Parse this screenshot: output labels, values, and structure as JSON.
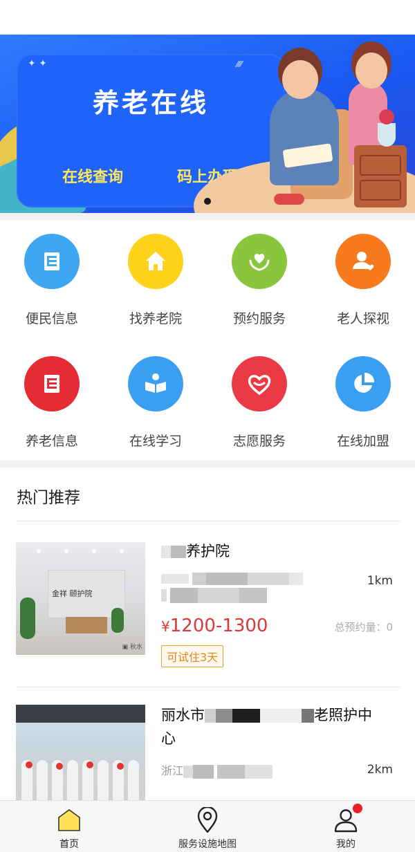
{
  "banner": {
    "title": "养老在线",
    "link_query": "在线查询",
    "link_handle": "码上办理"
  },
  "services": {
    "row1": [
      {
        "label": "便民信息",
        "icon": "document-icon",
        "color": "#3ea7f2"
      },
      {
        "label": "找养老院",
        "icon": "house-icon",
        "color": "#ffd21c"
      },
      {
        "label": "预约服务",
        "icon": "heart-hands-icon",
        "color": "#8ac53e"
      },
      {
        "label": "老人探视",
        "icon": "person-heart-icon",
        "color": "#f77a1f"
      }
    ],
    "row2": [
      {
        "label": "养老信息",
        "icon": "document-icon",
        "color": "#e52b34"
      },
      {
        "label": "在线学习",
        "icon": "reading-icon",
        "color": "#3a9ff0"
      },
      {
        "label": "志愿服务",
        "icon": "heart-icon",
        "color": "#ea3a45"
      },
      {
        "label": "在线加盟",
        "icon": "pie-icon",
        "color": "#3a9ff0"
      }
    ]
  },
  "hot": {
    "title": "热门推荐",
    "items": [
      {
        "name_suffix": "养护院",
        "distance": "1km",
        "price_symbol": "¥",
        "price": "1200-1300",
        "orders": "总预约量：0",
        "tag": "可试住3天",
        "thumb_brand": "金祥 颐护院"
      },
      {
        "name_prefix": "丽水市",
        "name_mid": "老照护中",
        "name_line2": "心",
        "addr_prefix": "浙江",
        "distance": "2km"
      }
    ]
  },
  "tabbar": {
    "home": "首页",
    "map": "服务设施地图",
    "mine": "我的"
  },
  "colors": {
    "price": "#d83a3a",
    "tag": "#e08a1e",
    "badge": "#e8212b"
  }
}
